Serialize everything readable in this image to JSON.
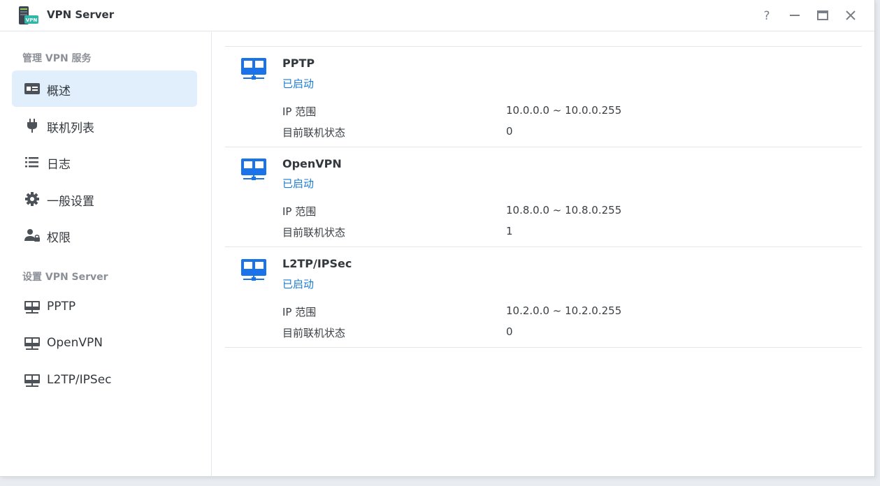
{
  "app": {
    "title": "VPN Server",
    "icon": "vpn-server-app-icon",
    "icon_badge": "VPN"
  },
  "window_controls": [
    "help-icon",
    "minimize-icon",
    "maximize-icon",
    "close-icon"
  ],
  "sidebar": {
    "section1_title": "管理 VPN 服务",
    "section2_title": "设置 VPN Server",
    "manage_items": [
      {
        "label": "概述",
        "icon": "overview-card-icon",
        "active": true
      },
      {
        "label": "联机列表",
        "icon": "plug-icon"
      },
      {
        "label": "日志",
        "icon": "list-icon"
      },
      {
        "label": "一般设置",
        "icon": "gear-icon"
      },
      {
        "label": "权限",
        "icon": "user-lock-icon"
      }
    ],
    "setup_items": [
      {
        "label": "PPTP",
        "icon": "network-icon"
      },
      {
        "label": "OpenVPN",
        "icon": "network-icon"
      },
      {
        "label": "L2TP/IPSec",
        "icon": "network-icon"
      }
    ]
  },
  "services": [
    {
      "name": "PPTP",
      "status": "已启动",
      "ip_range_label": "IP 范围",
      "ip_range": "10.0.0.0 ~ 10.0.0.255",
      "connections_label": "目前联机状态",
      "connections": "0"
    },
    {
      "name": "OpenVPN",
      "status": "已启动",
      "ip_range_label": "IP 范围",
      "ip_range": "10.8.0.0 ~ 10.8.0.255",
      "connections_label": "目前联机状态",
      "connections": "1"
    },
    {
      "name": "L2TP/IPSec",
      "status": "已启动",
      "ip_range_label": "IP 范围",
      "ip_range": "10.2.0.0 ~ 10.2.0.255",
      "connections_label": "目前联机状态",
      "connections": "0"
    }
  ],
  "colors": {
    "accent": "#1a7bd6",
    "active_nav_bg": "#e1eefb",
    "service_icon": "#1a73e8"
  }
}
